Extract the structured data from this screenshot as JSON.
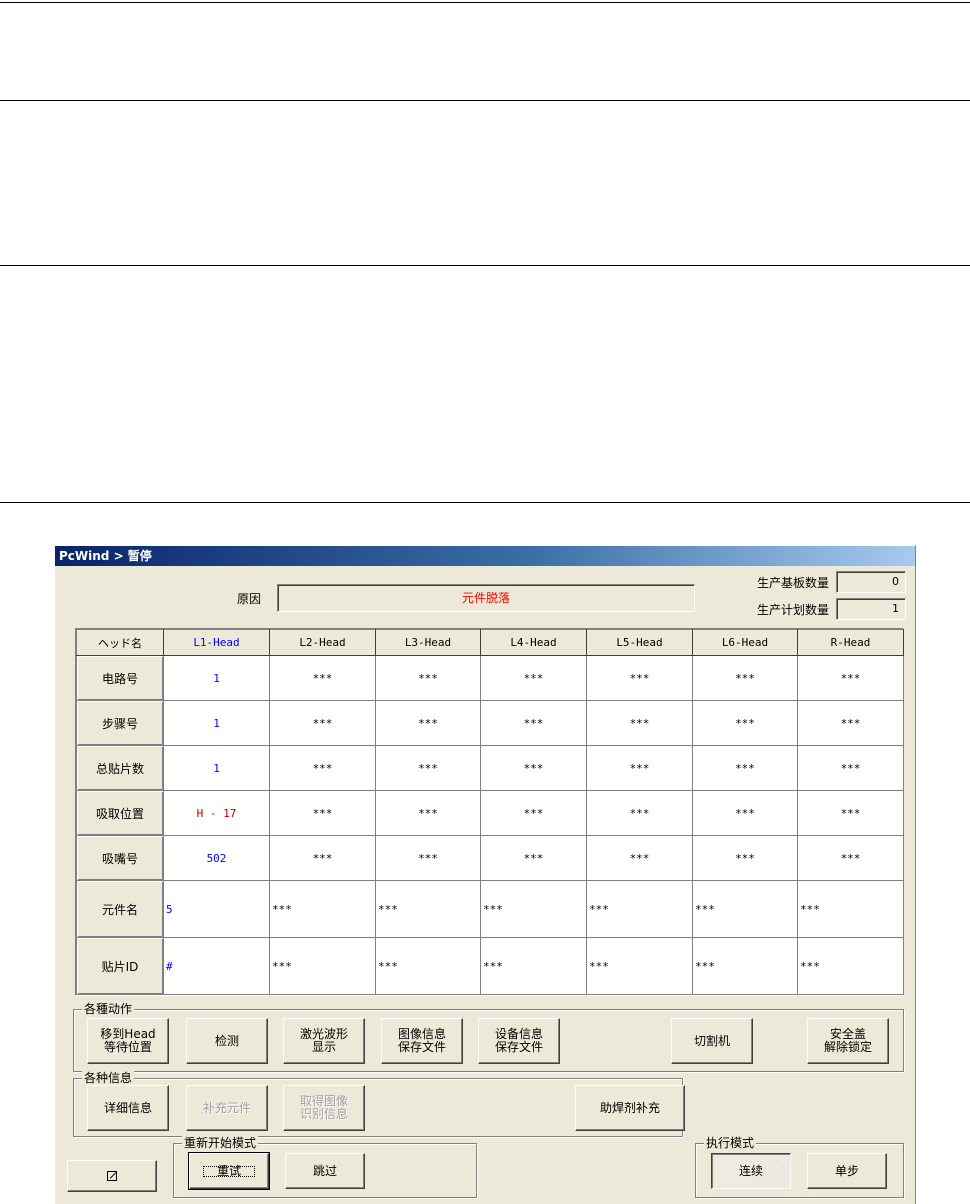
{
  "window": {
    "title": "PcWind > 暂停"
  },
  "reason": {
    "label": "原因",
    "value": "元件脱落"
  },
  "counts": [
    {
      "label": "生产基板数量",
      "value": "0"
    },
    {
      "label": "生产计划数量",
      "value": "1"
    }
  ],
  "table": {
    "corner": "ヘッド名",
    "columns": [
      "L1-Head",
      "L2-Head",
      "L3-Head",
      "L4-Head",
      "L5-Head",
      "L6-Head",
      "R-Head"
    ],
    "rows": [
      {
        "label": "电路号",
        "cells": [
          "1",
          "***",
          "***",
          "***",
          "***",
          "***",
          "***"
        ]
      },
      {
        "label": "步骤号",
        "cells": [
          "1",
          "***",
          "***",
          "***",
          "***",
          "***",
          "***"
        ]
      },
      {
        "label": "总贴片数",
        "cells": [
          "1",
          "***",
          "***",
          "***",
          "***",
          "***",
          "***"
        ]
      },
      {
        "label": "吸取位置",
        "cells": [
          "H - 17",
          "***",
          "***",
          "***",
          "***",
          "***",
          "***"
        ]
      },
      {
        "label": "吸嘴号",
        "cells": [
          "502",
          "***",
          "***",
          "***",
          "***",
          "***",
          "***"
        ]
      },
      {
        "label": "元件名",
        "cells": [
          "5",
          "***",
          "***",
          "***",
          "***",
          "***",
          "***"
        ]
      },
      {
        "label": "贴片ID",
        "cells": [
          "#",
          "***",
          "***",
          "***",
          "***",
          "***",
          "***"
        ]
      }
    ]
  },
  "actions": {
    "title": "各種动作",
    "buttons": [
      "移到Head\n等待位置",
      "检测",
      "激光波形\n显示",
      "图像信息\n保存文件",
      "设备信息\n保存文件",
      "切割机",
      "安全盖\n解除锁定"
    ]
  },
  "info": {
    "title": "各种信息",
    "buttons": [
      "详细信息",
      "补充元件",
      "取得图像\n识别信息",
      "助焊剂补充"
    ]
  },
  "restart": {
    "title": "重新开始模式",
    "retry": "重试",
    "skip": "跳过"
  },
  "exec": {
    "title": "执行模式",
    "continuous": "连续",
    "step": "单步"
  },
  "corner_button": {
    "icon": "resize-icon"
  }
}
